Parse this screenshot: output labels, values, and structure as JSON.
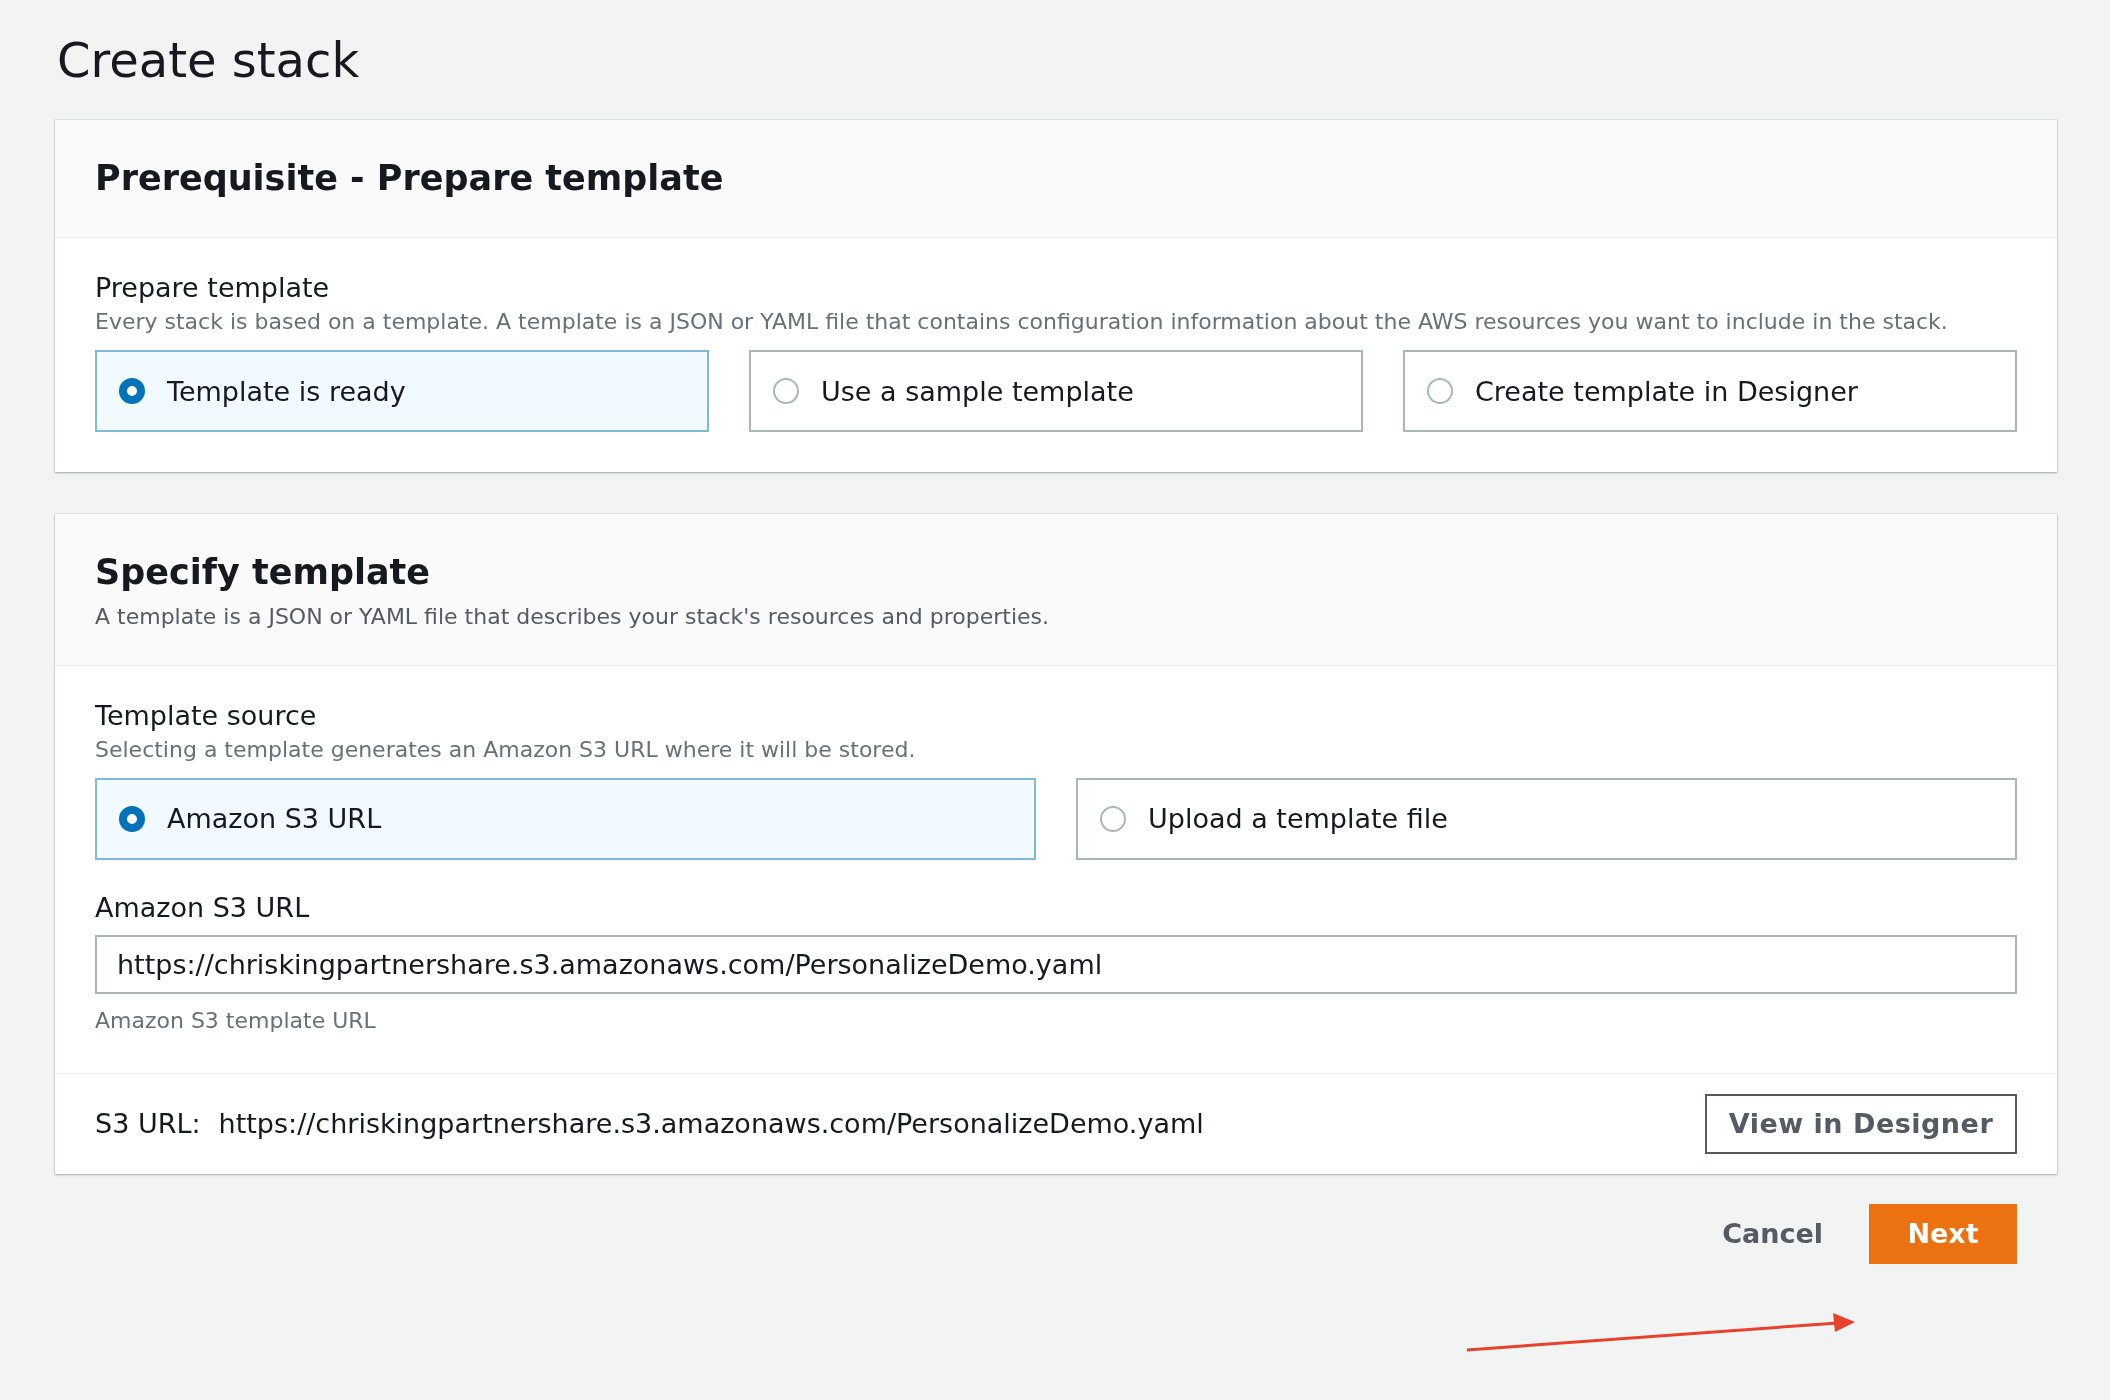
{
  "page_title": "Create stack",
  "prepare_panel": {
    "title": "Prerequisite - Prepare template",
    "field": {
      "label": "Prepare template",
      "description": "Every stack is based on a template. A template is a JSON or YAML file that contains configuration information about the AWS resources you want to include in the stack.",
      "options": [
        {
          "label": "Template is ready",
          "selected": true
        },
        {
          "label": "Use a sample template",
          "selected": false
        },
        {
          "label": "Create template in Designer",
          "selected": false
        }
      ]
    }
  },
  "specify_panel": {
    "title": "Specify template",
    "description": "A template is a JSON or YAML file that describes your stack's resources and properties.",
    "source": {
      "label": "Template source",
      "description": "Selecting a template generates an Amazon S3 URL where it will be stored.",
      "options": [
        {
          "label": "Amazon S3 URL",
          "selected": true
        },
        {
          "label": "Upload a template file",
          "selected": false
        }
      ]
    },
    "url_field": {
      "label": "Amazon S3 URL",
      "value": "https://chriskingpartnershare.s3.amazonaws.com/PersonalizeDemo.yaml",
      "hint": "Amazon S3 template URL"
    },
    "footer": {
      "label": "S3 URL:",
      "value": "https://chriskingpartnershare.s3.amazonaws.com/PersonalizeDemo.yaml",
      "button": "View in Designer"
    }
  },
  "actions": {
    "cancel": "Cancel",
    "next": "Next"
  }
}
